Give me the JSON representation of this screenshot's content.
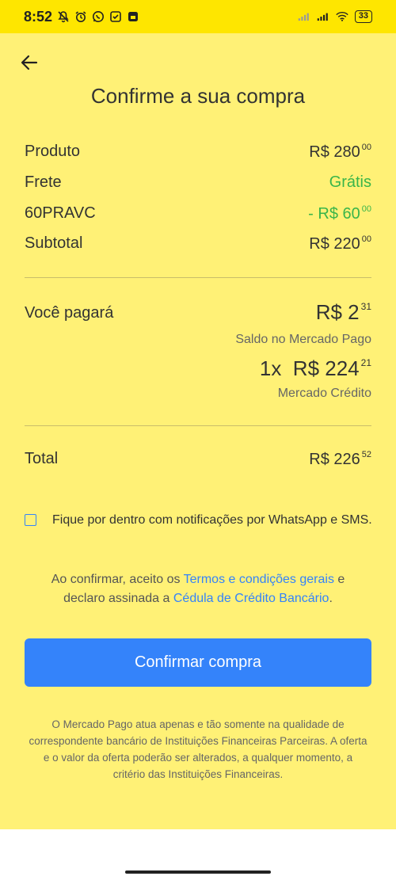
{
  "status": {
    "time": "8:52",
    "battery": "33"
  },
  "header": {
    "title": "Confirme a sua compra"
  },
  "summary": {
    "product": {
      "label": "Produto",
      "value": "R$ 280",
      "cents": "00"
    },
    "shipping": {
      "label": "Frete",
      "value": "Grátis"
    },
    "coupon": {
      "label": "60PRAVC",
      "value": "- R$ 60",
      "cents": "00"
    },
    "subtotal": {
      "label": "Subtotal",
      "value": "R$ 220",
      "cents": "00"
    }
  },
  "payment": {
    "label": "Você pagará",
    "balance_amount": "R$ 2",
    "balance_cents": "31",
    "balance_source": "Saldo no Mercado Pago",
    "credit_installments": "1x",
    "credit_amount": "R$ 224",
    "credit_cents": "21",
    "credit_source": "Mercado Crédito"
  },
  "total": {
    "label": "Total",
    "value": "R$ 226",
    "cents": "52"
  },
  "notifications": {
    "checked": false,
    "label": "Fique por dentro com notificações por WhatsApp e SMS."
  },
  "terms": {
    "prefix": "Ao confirmar, aceito os ",
    "link1": "Termos e condições gerais",
    "middle": " e declaro assinada a ",
    "link2": "Cédula de Crédito Bancário",
    "suffix": "."
  },
  "confirm_button": "Confirmar compra",
  "disclaimer": "O Mercado Pago atua apenas e tão somente na qualidade de correspondente bancário de Instituições Financeiras Parceiras. A oferta e o valor da oferta poderão ser alterados, a qualquer momento, a critério das Instituições Financeiras.",
  "colors": {
    "header_yellow": "#fee600",
    "background": "#fff176",
    "accent_blue": "#3483fa",
    "success_green": "#39b54a"
  }
}
